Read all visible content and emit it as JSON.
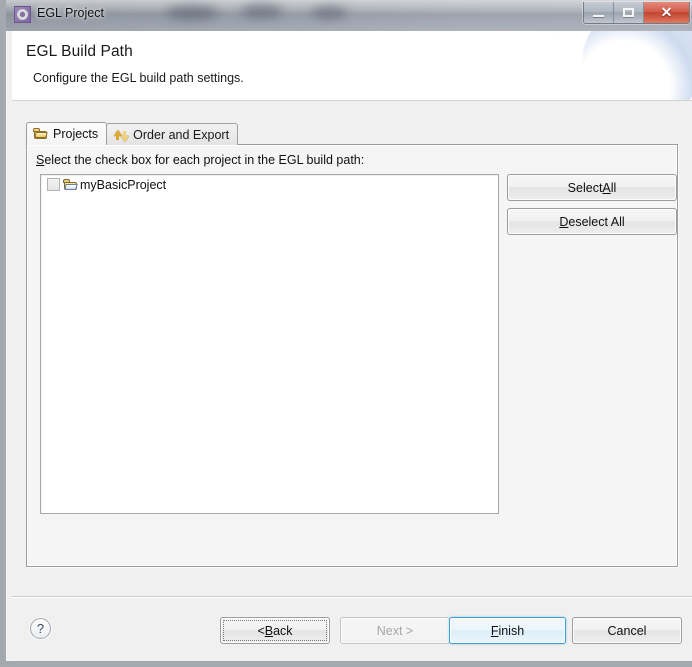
{
  "window": {
    "title": "EGL Project",
    "app_icon": "egl-project-icon",
    "controls": {
      "minimize": "minimize-icon",
      "maximize": "maximize-icon",
      "close": "✕"
    }
  },
  "banner": {
    "title": "EGL Build Path",
    "subtitle": "Configure the EGL build path settings."
  },
  "tabs": [
    {
      "label": "Projects",
      "icon": "folder-icon",
      "active": true
    },
    {
      "label": "Order and Export",
      "icon": "order-export-icon",
      "active": false
    }
  ],
  "projects_tab": {
    "field_label_prefix": "S",
    "field_label_rest": "elect the check box for each project in the EGL build path:",
    "list": [
      {
        "label": "myBasicProject",
        "checked": false,
        "icon": "project-folder-icon"
      }
    ],
    "buttons": [
      {
        "id": "select-all",
        "mnemonic_before": "Select ",
        "mnemonic": "A",
        "mnemonic_after": "ll"
      },
      {
        "id": "deselect-all",
        "mnemonic_before": "",
        "mnemonic": "D",
        "mnemonic_after": "eselect All"
      }
    ]
  },
  "footer": {
    "help_icon": "?",
    "buttons": [
      {
        "id": "back",
        "before": "< ",
        "mnemonic": "B",
        "after": "ack",
        "state": "focused"
      },
      {
        "id": "next",
        "before": "Next >",
        "mnemonic": "",
        "after": "",
        "state": "disabled"
      },
      {
        "id": "finish",
        "before": "",
        "mnemonic": "F",
        "after": "inish",
        "state": "default"
      },
      {
        "id": "cancel",
        "before": "Cancel",
        "mnemonic": "",
        "after": "",
        "state": "normal"
      }
    ]
  },
  "colors": {
    "accent_blue": "#3c9fd6",
    "banner_bg": "#ffffff",
    "dialog_bg": "#f0f0f0",
    "close_red": "#c0432f"
  }
}
